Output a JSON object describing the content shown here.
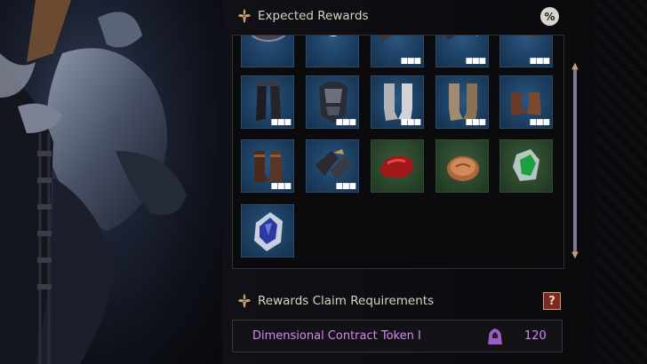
{
  "rewards": {
    "title": "Expected Rewards",
    "percent_label": "%",
    "items": [
      {
        "name": "emblem-item",
        "type": "blue",
        "dots": ""
      },
      {
        "name": "orb-item",
        "type": "blue",
        "dots": ""
      },
      {
        "name": "crossbow-item",
        "type": "blue",
        "dots": "■■■"
      },
      {
        "name": "bow-item",
        "type": "blue",
        "dots": "■■■"
      },
      {
        "name": "dagger-item",
        "type": "blue",
        "dots": "■■■"
      },
      {
        "name": "dark-leggings-item",
        "type": "blue",
        "dots": "■■■"
      },
      {
        "name": "chest-armor-item",
        "type": "blue",
        "dots": "■■■"
      },
      {
        "name": "white-boots-item",
        "type": "blue",
        "dots": "■■■"
      },
      {
        "name": "brown-boots-item",
        "type": "blue",
        "dots": "■■■"
      },
      {
        "name": "leather-shoes-item",
        "type": "blue",
        "dots": "■■■"
      },
      {
        "name": "leather-boots-item",
        "type": "blue",
        "dots": "■■■"
      },
      {
        "name": "gauntlets-item",
        "type": "blue",
        "dots": "■■■"
      },
      {
        "name": "red-gem-item",
        "type": "green",
        "dots": ""
      },
      {
        "name": "bronze-coin-item",
        "type": "green",
        "dots": ""
      },
      {
        "name": "green-crystal-item",
        "type": "green",
        "dots": ""
      },
      {
        "name": "blue-crystal-item",
        "type": "blue",
        "dots": ""
      }
    ]
  },
  "requirements": {
    "title": "Rewards Claim Requirements",
    "help_label": "?",
    "item_name": "Dimensional Contract Token I",
    "item_qty": "120"
  },
  "colors": {
    "accent_purple": "#d986f0",
    "slot_blue": "#1c3e60",
    "slot_green": "#2a452c",
    "gold": "#c8a070"
  }
}
